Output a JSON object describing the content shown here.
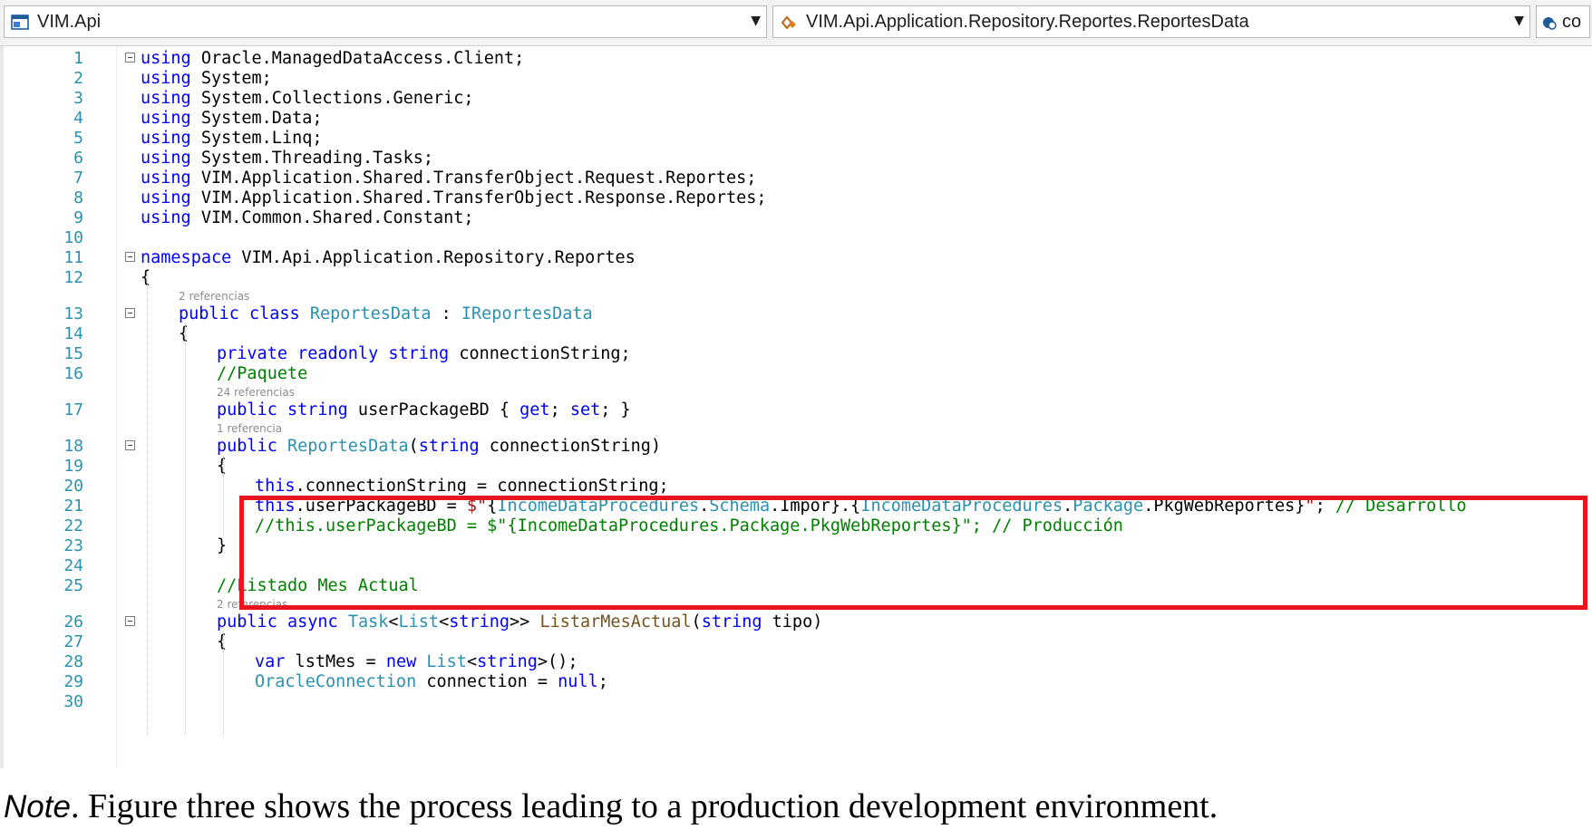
{
  "navbar": {
    "project": "VIM.Api",
    "type": "VIM.Api.Application.Repository.Reportes.ReportesData",
    "member": "co"
  },
  "lines": [
    {
      "n": "1",
      "segs": [
        [
          "kw",
          "using"
        ],
        [
          "nm",
          " Oracle.ManagedDataAccess.Client;"
        ]
      ],
      "indent": 0,
      "fold": true
    },
    {
      "n": "2",
      "segs": [
        [
          "kw",
          "using"
        ],
        [
          "nm",
          " System;"
        ]
      ],
      "indent": 0
    },
    {
      "n": "3",
      "segs": [
        [
          "kw",
          "using"
        ],
        [
          "nm",
          " System.Collections.Generic;"
        ]
      ],
      "indent": 0
    },
    {
      "n": "4",
      "segs": [
        [
          "kw",
          "using"
        ],
        [
          "nm",
          " System.Data;"
        ]
      ],
      "indent": 0
    },
    {
      "n": "5",
      "segs": [
        [
          "kw",
          "using"
        ],
        [
          "nm",
          " System.Linq;"
        ]
      ],
      "indent": 0
    },
    {
      "n": "6",
      "segs": [
        [
          "kw",
          "using"
        ],
        [
          "nm",
          " System.Threading.Tasks;"
        ]
      ],
      "indent": 0
    },
    {
      "n": "7",
      "segs": [
        [
          "kw",
          "using"
        ],
        [
          "nm",
          " VIM.Application.Shared.TransferObject.Request.Reportes;"
        ]
      ],
      "indent": 0
    },
    {
      "n": "8",
      "segs": [
        [
          "kw",
          "using"
        ],
        [
          "nm",
          " VIM.Application.Shared.TransferObject.Response.Reportes;"
        ]
      ],
      "indent": 0
    },
    {
      "n": "9",
      "segs": [
        [
          "kw",
          "using"
        ],
        [
          "nm",
          " VIM.Common.Shared.Constant;"
        ]
      ],
      "indent": 0
    },
    {
      "n": "10",
      "segs": [],
      "indent": 0
    },
    {
      "n": "11",
      "segs": [
        [
          "kw",
          "namespace"
        ],
        [
          "nm",
          " VIM.Api.Application.Repository.Reportes"
        ]
      ],
      "indent": 0,
      "fold": true
    },
    {
      "n": "12",
      "segs": [
        [
          "nm",
          "{"
        ]
      ],
      "indent": 0
    },
    {
      "n": "13",
      "segs": [
        [
          "kw",
          "public"
        ],
        [
          "nm",
          " "
        ],
        [
          "kw",
          "class"
        ],
        [
          "nm",
          " "
        ],
        [
          "ty",
          "ReportesData"
        ],
        [
          "nm",
          " : "
        ],
        [
          "ty",
          "IReportesData"
        ]
      ],
      "indent": 1,
      "fold": true,
      "lens": "2 referencias"
    },
    {
      "n": "14",
      "segs": [
        [
          "nm",
          "{"
        ]
      ],
      "indent": 1
    },
    {
      "n": "15",
      "segs": [
        [
          "kw",
          "private"
        ],
        [
          "nm",
          " "
        ],
        [
          "kw",
          "readonly"
        ],
        [
          "nm",
          " "
        ],
        [
          "kw",
          "string"
        ],
        [
          "nm",
          " connectionString;"
        ]
      ],
      "indent": 2
    },
    {
      "n": "16",
      "segs": [
        [
          "cm",
          "//Paquete"
        ]
      ],
      "indent": 2
    },
    {
      "n": "17",
      "segs": [
        [
          "kw",
          "public"
        ],
        [
          "nm",
          " "
        ],
        [
          "kw",
          "string"
        ],
        [
          "nm",
          " userPackageBD { "
        ],
        [
          "kw",
          "get"
        ],
        [
          "nm",
          "; "
        ],
        [
          "kw",
          "set"
        ],
        [
          "nm",
          "; }"
        ]
      ],
      "indent": 2,
      "lens": "24 referencias"
    },
    {
      "n": "18",
      "segs": [
        [
          "kw",
          "public"
        ],
        [
          "nm",
          " "
        ],
        [
          "ty",
          "ReportesData"
        ],
        [
          "nm",
          "("
        ],
        [
          "kw",
          "string"
        ],
        [
          "nm",
          " connectionString)"
        ]
      ],
      "indent": 2,
      "fold": true,
      "lens": "1 referencia"
    },
    {
      "n": "19",
      "segs": [
        [
          "nm",
          "{"
        ]
      ],
      "indent": 2
    },
    {
      "n": "20",
      "segs": [
        [
          "kw",
          "this"
        ],
        [
          "nm",
          ".connectionString = connectionString;"
        ]
      ],
      "indent": 3
    },
    {
      "n": "21",
      "segs": [
        [
          "kw",
          "this"
        ],
        [
          "nm",
          ".userPackageBD = "
        ],
        [
          "st",
          "$\""
        ],
        [
          "nm",
          "{"
        ],
        [
          "ty",
          "IncomeDataProcedures"
        ],
        [
          "nm",
          "."
        ],
        [
          "ty",
          "Schema"
        ],
        [
          "nm",
          ".Impor}.{"
        ],
        [
          "ty",
          "IncomeDataProcedures"
        ],
        [
          "nm",
          "."
        ],
        [
          "ty",
          "Package"
        ],
        [
          "nm",
          ".PkgWebReportes}"
        ],
        [
          "st",
          "\""
        ],
        [
          "nm",
          "; "
        ],
        [
          "cm",
          "// Desarrollo"
        ]
      ],
      "indent": 3
    },
    {
      "n": "22",
      "segs": [
        [
          "cm",
          "//this.userPackageBD = $\"{IncomeDataProcedures.Package.PkgWebReportes}\"; // Producción"
        ]
      ],
      "indent": 3
    },
    {
      "n": "23",
      "segs": [
        [
          "nm",
          "}"
        ]
      ],
      "indent": 2
    },
    {
      "n": "24",
      "segs": [],
      "indent": 0
    },
    {
      "n": "25",
      "segs": [
        [
          "cm",
          "//Listado Mes Actual"
        ]
      ],
      "indent": 2
    },
    {
      "n": "26",
      "segs": [
        [
          "kw",
          "public"
        ],
        [
          "nm",
          " "
        ],
        [
          "kw",
          "async"
        ],
        [
          "nm",
          " "
        ],
        [
          "ty",
          "Task"
        ],
        [
          "nm",
          "<"
        ],
        [
          "ty",
          "List"
        ],
        [
          "nm",
          "<"
        ],
        [
          "kw",
          "string"
        ],
        [
          "nm",
          ">> "
        ],
        [
          "mt",
          "ListarMesActual"
        ],
        [
          "nm",
          "("
        ],
        [
          "kw",
          "string"
        ],
        [
          "nm",
          " tipo)"
        ]
      ],
      "indent": 2,
      "fold": true,
      "lens": "2 referencias"
    },
    {
      "n": "27",
      "segs": [
        [
          "nm",
          "{"
        ]
      ],
      "indent": 2
    },
    {
      "n": "28",
      "segs": [
        [
          "kw",
          "var"
        ],
        [
          "nm",
          " lstMes = "
        ],
        [
          "kw",
          "new"
        ],
        [
          "nm",
          " "
        ],
        [
          "ty",
          "List"
        ],
        [
          "nm",
          "<"
        ],
        [
          "kw",
          "string"
        ],
        [
          "nm",
          ">();"
        ]
      ],
      "indent": 3
    },
    {
      "n": "29",
      "segs": [
        [
          "ty",
          "OracleConnection"
        ],
        [
          "nm",
          " connection = "
        ],
        [
          "kw",
          "null"
        ],
        [
          "nm",
          ";"
        ]
      ],
      "indent": 3
    },
    {
      "n": "30",
      "segs": [],
      "indent": 3
    }
  ],
  "note": {
    "label": "Note",
    "text": ". Figure three shows the process leading to a production development environment."
  }
}
